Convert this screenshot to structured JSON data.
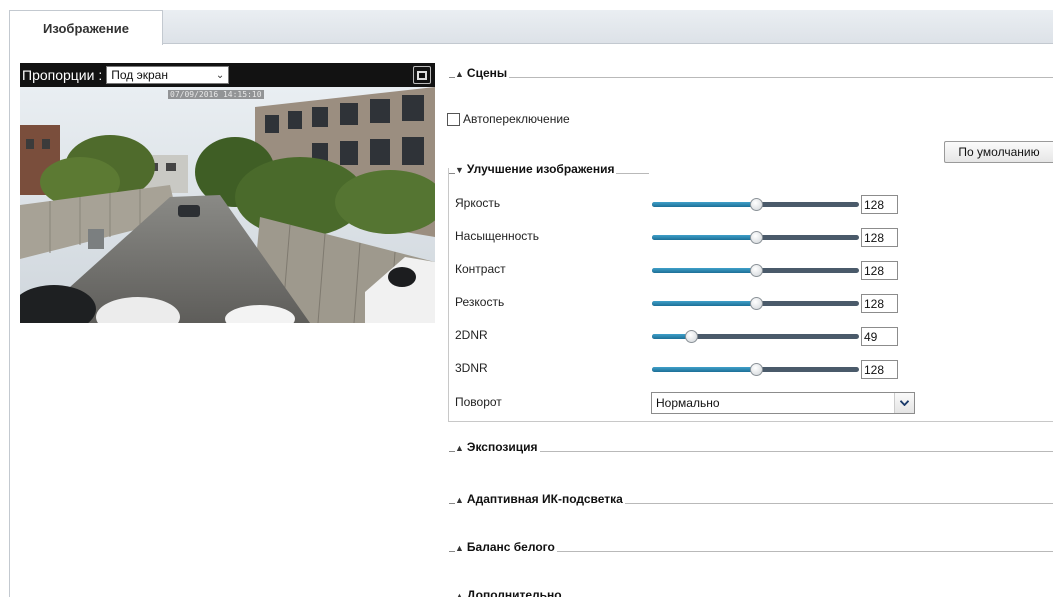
{
  "tabs": [
    {
      "label": "Изображение",
      "active": true
    }
  ],
  "preview": {
    "aspect_label": "Пропорции :",
    "aspect_value": "Под экран",
    "timestamp": "07/09/2016 14:15:10",
    "fullscreen_icon": "fullscreen-icon"
  },
  "sections": {
    "scenes": {
      "title": "Сцены",
      "state": "collapsed"
    },
    "auto_switch": {
      "label": "Автопереключение",
      "checked": false
    },
    "default_button": "По умолчанию",
    "enhancement": {
      "title": "Улучшение изображения",
      "state": "expanded"
    },
    "exposure": {
      "title": "Экспозиция"
    },
    "adaptive_ir": {
      "title": "Адаптивная ИК-подсветка"
    },
    "white_balance": {
      "title": "Баланс белого"
    },
    "advanced": {
      "title": "Дополнительно"
    }
  },
  "params": [
    {
      "label": "Яркость",
      "value": "128",
      "level": 0.5
    },
    {
      "label": "Насыщенность",
      "value": "128",
      "level": 0.5
    },
    {
      "label": "Контраст",
      "value": "128",
      "level": 0.5
    },
    {
      "label": "Резкость",
      "value": "128",
      "level": 0.5
    },
    {
      "label": "2DNR",
      "value": "49",
      "level": 0.19
    },
    {
      "label": "3DNR",
      "value": "128",
      "level": 0.5
    }
  ],
  "rotate": {
    "label": "Поворот",
    "value": "Нормально"
  },
  "colors": {
    "slider_fill": "#2a87b3",
    "slider_track": "#4a5a6a",
    "tab_bar": "#e3e7ec",
    "caption": "#5b8ec9"
  }
}
